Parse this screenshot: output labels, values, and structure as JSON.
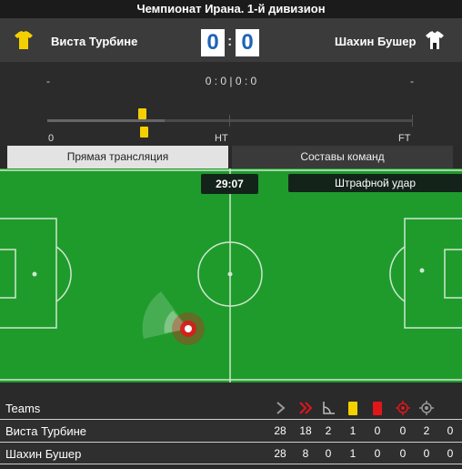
{
  "competition": "Чемпионат Ирана. 1-й дивизион",
  "home": {
    "name": "Виста Турбине",
    "score": "0",
    "kit_color": "#f5d000"
  },
  "away": {
    "name": "Шахин Бушер",
    "score": "0",
    "kit_color": "#ffffff"
  },
  "score_separator": ":",
  "info": {
    "home_dash": "-",
    "away_dash": "-",
    "halftime_scores": "0 : 0 | 0 : 0"
  },
  "timeline": {
    "start_label": "0",
    "ht_label": "HT",
    "ft_label": "FT",
    "progress_fraction": 0.32,
    "yellow_cards": 2
  },
  "tabs": {
    "live": "Прямая трансляция",
    "lineups": "Составы команд"
  },
  "match_clock": "29:07",
  "event": "Штрафной удар",
  "stats": {
    "header_label": "Teams",
    "icons": [
      "attacks-icon",
      "dangerous-attacks-icon",
      "corners-icon",
      "yellow-card-icon",
      "red-card-icon",
      "shots-on-target-icon",
      "shots-off-target-icon"
    ],
    "rows": [
      {
        "team": "Виста Турбине",
        "values": [
          "28",
          "18",
          "2",
          "1",
          "0",
          "0",
          "2",
          "0"
        ]
      },
      {
        "team": "Шахин Бушер",
        "values": [
          "28",
          "8",
          "0",
          "1",
          "0",
          "0",
          "0",
          "0"
        ]
      }
    ]
  },
  "colors": {
    "pitch": "#1f9b2c",
    "accent_score": "#1e63b8",
    "card_yellow": "#f5d000",
    "card_red": "#e0161b"
  }
}
